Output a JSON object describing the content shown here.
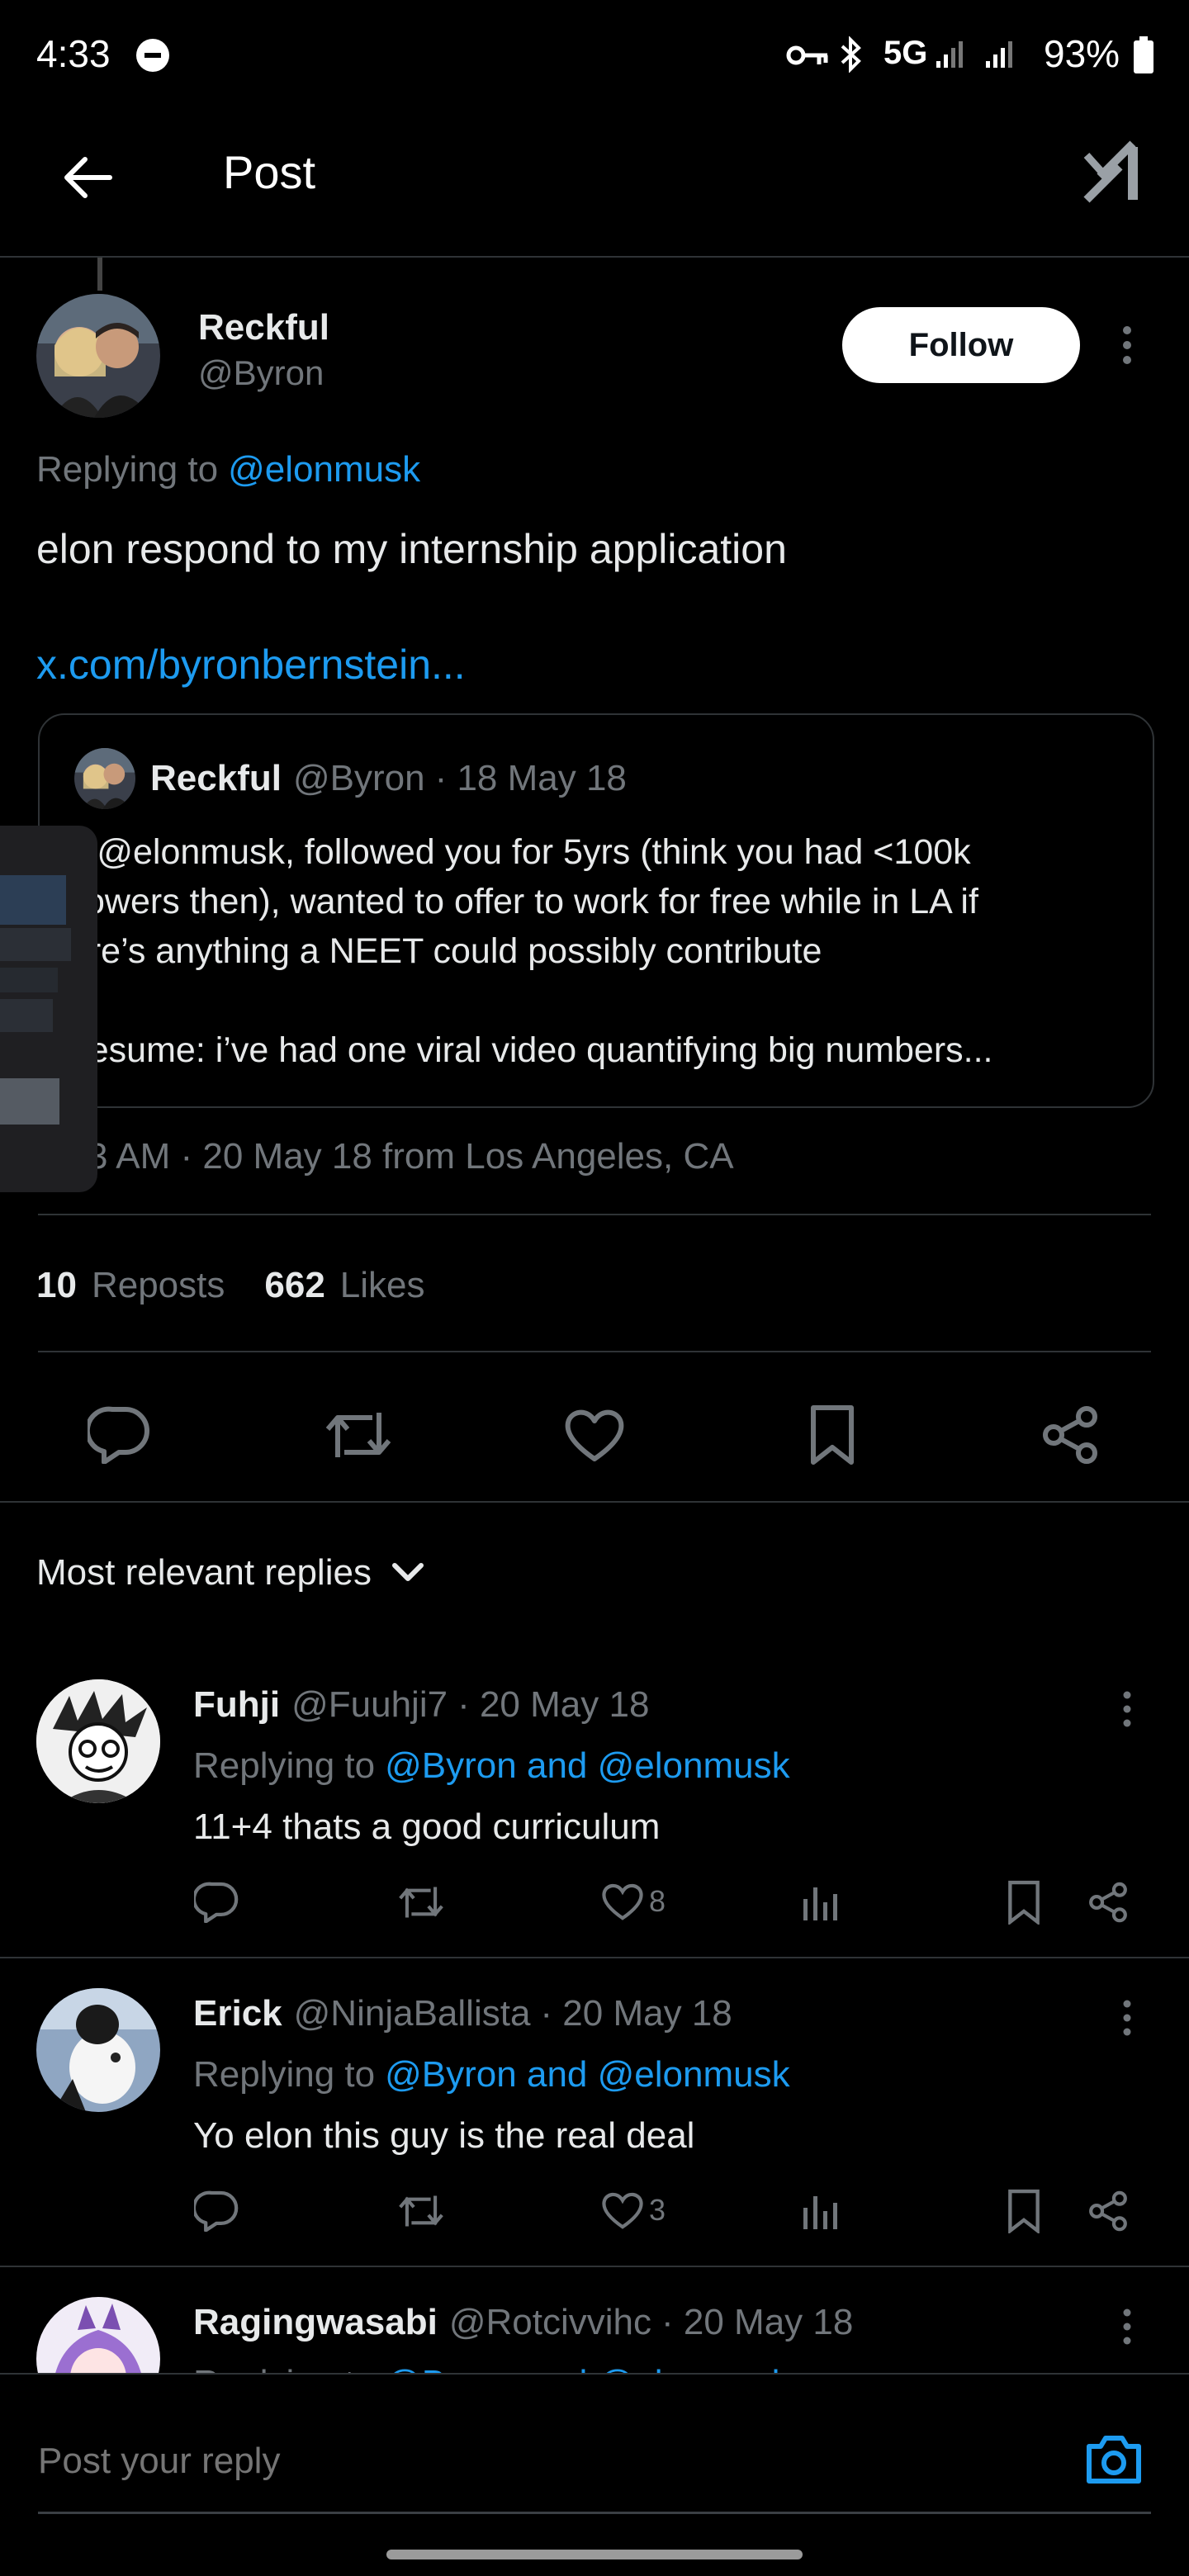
{
  "status_bar": {
    "time": "4:33",
    "network": "5G",
    "battery": "93%"
  },
  "header": {
    "title": "Post",
    "logo": "x-grok-logo"
  },
  "post": {
    "author_name": "Reckful",
    "author_handle": "@Byron",
    "follow_label": "Follow",
    "replying_prefix": "Replying to",
    "replying_to": "@elonmusk",
    "text": "elon respond to my internship application",
    "link": "x.com/byronbernstein...",
    "quote": {
      "author_name": "Reckful",
      "author_handle": "@Byron",
      "date": "· 18 May 18",
      "line1": "ey @elonmusk, followed you for 5yrs (think you had <100k",
      "line2": "ollowers then), wanted to offer to work for free while in LA if",
      "line3": "here’s anything a NEET could possibly contribute",
      "line4": "y resume: i’ve had one viral video quantifying big numbers..."
    },
    "meta": "3 AM · 20 May 18 from Los Angeles, CA",
    "reposts_count": "10",
    "reposts_label": "Reposts",
    "likes_count": "662",
    "likes_label": "Likes"
  },
  "replies_sort": {
    "label": "Most relevant replies"
  },
  "replies": [
    {
      "name": "Fuhji",
      "handle": "@Fuuhji7",
      "date": "· 20 May 18",
      "replying_prefix": "Replying to",
      "replying_to": "@Byron and @elonmusk",
      "text": "11+4 thats a good curriculum",
      "likes": "8"
    },
    {
      "name": "Erick",
      "handle": "@NinjaBallista",
      "date": "· 20 May 18",
      "replying_prefix": "Replying to",
      "replying_to": "@Byron and @elonmusk",
      "text": "Yo elon this guy is the real deal",
      "likes": "3"
    },
    {
      "name": "Ragingwasabi",
      "handle": "@Rotcivvihc",
      "date": "· 20 May 18",
      "replying_prefix": "Replying to",
      "replying_to": "@Byron and @elonmusk"
    }
  ],
  "composer": {
    "placeholder": "Post your reply"
  },
  "colors": {
    "accent": "#1d9bf0",
    "background": "#000000",
    "muted": "#71767b",
    "divider": "#2f3336"
  }
}
